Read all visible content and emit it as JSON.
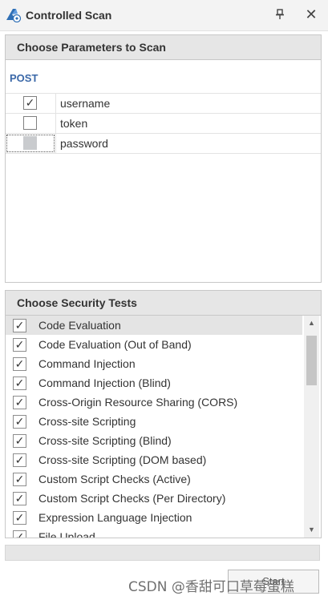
{
  "window": {
    "title": "Controlled Scan"
  },
  "params_panel": {
    "header": "Choose Parameters to Scan",
    "method": "POST",
    "params": [
      {
        "name": "username",
        "checked": true
      },
      {
        "name": "token",
        "checked": false
      },
      {
        "name": "password",
        "checked": false,
        "state": "indeterminate"
      }
    ]
  },
  "tests_panel": {
    "header": "Choose Security Tests",
    "tests": [
      {
        "label": "Code Evaluation",
        "checked": true
      },
      {
        "label": "Code Evaluation (Out of Band)",
        "checked": true
      },
      {
        "label": "Command Injection",
        "checked": true
      },
      {
        "label": "Command Injection (Blind)",
        "checked": true
      },
      {
        "label": "Cross-Origin Resource Sharing (CORS)",
        "checked": true
      },
      {
        "label": "Cross-site Scripting",
        "checked": true
      },
      {
        "label": "Cross-site Scripting (Blind)",
        "checked": true
      },
      {
        "label": "Cross-site Scripting (DOM based)",
        "checked": true
      },
      {
        "label": "Custom Script Checks (Active)",
        "checked": true
      },
      {
        "label": "Custom Script Checks (Per Directory)",
        "checked": true
      },
      {
        "label": "Expression Language Injection",
        "checked": true
      },
      {
        "label": "File Upload",
        "checked": true
      }
    ]
  },
  "check_mark": "✓",
  "start_button": "Start",
  "watermark": "CSDN @香甜可口草莓蛋糕",
  "icons": {
    "app": "shark-fin-icon",
    "pin": "pin-icon",
    "close": "close-icon",
    "scroll_up": "arrow-up-icon",
    "scroll_down": "arrow-down-icon"
  },
  "colors": {
    "method": "#3b68a8",
    "header_bg": "#e6e6e6",
    "selected_row": "#e4e4e4",
    "indeterminate": "#c9cbce"
  }
}
